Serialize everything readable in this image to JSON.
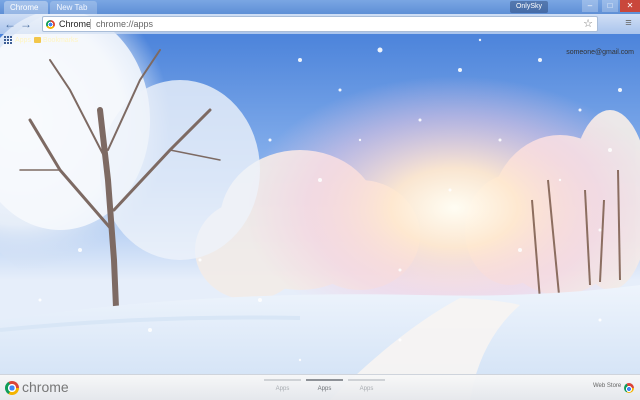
{
  "browser": {
    "tabs": [
      {
        "label": "Chrome"
      },
      {
        "label": "New Tab"
      }
    ],
    "user_badge": "OnlySky",
    "window_controls": {
      "minimize": "–",
      "maximize": "□",
      "close": "✕"
    }
  },
  "toolbar": {
    "back_icon": "arrow-left-icon",
    "forward_icon": "arrow-right-icon",
    "site_label": "Chrome",
    "url": "chrome://apps",
    "star_icon": "star-icon",
    "menu_icon": "menu-icon"
  },
  "bookmarks": {
    "apps_label": "Apps",
    "items": [
      {
        "label": "Bookmarks"
      }
    ]
  },
  "account": "someone@gmail.com",
  "bottom_bar": {
    "brand": "chrome",
    "pages": [
      {
        "label": "Apps",
        "active": false
      },
      {
        "label": "Apps",
        "active": true
      },
      {
        "label": "Apps",
        "active": false
      }
    ],
    "web_store_label": "Web Store"
  },
  "colors": {
    "sky": "#4d86e0",
    "snow": "#f4f8fd",
    "sun": "#ffe6c8",
    "trunk": "#7a5a4a"
  }
}
